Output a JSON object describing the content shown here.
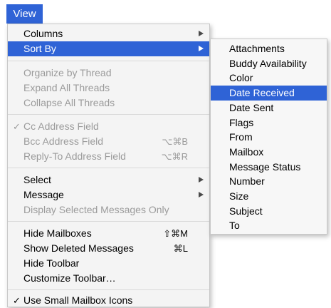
{
  "menubar": {
    "view_label": "View"
  },
  "menu": {
    "columns": "Columns",
    "sort_by": "Sort By",
    "organize_by_thread": "Organize by Thread",
    "expand_all_threads": "Expand All Threads",
    "collapse_all_threads": "Collapse All Threads",
    "cc_address_field": "Cc Address Field",
    "bcc_address_field": "Bcc Address Field",
    "bcc_shortcut": "⌥⌘B",
    "reply_to_address_field": "Reply-To Address Field",
    "reply_to_shortcut": "⌥⌘R",
    "select": "Select",
    "message": "Message",
    "display_selected_messages_only": "Display Selected Messages Only",
    "hide_mailboxes": "Hide Mailboxes",
    "hide_mailboxes_shortcut": "⇧⌘M",
    "show_deleted_messages": "Show Deleted Messages",
    "show_deleted_shortcut": "⌘L",
    "hide_toolbar": "Hide Toolbar",
    "customize_toolbar": "Customize Toolbar…",
    "use_small_mailbox_icons": "Use Small Mailbox Icons",
    "checkmark": "✓"
  },
  "submenu": {
    "items": [
      "Attachments",
      "Buddy Availability",
      "Color",
      "Date Received",
      "Date Sent",
      "Flags",
      "From",
      "Mailbox",
      "Message Status",
      "Number",
      "Size",
      "Subject",
      "To"
    ],
    "selected": "Date Received"
  },
  "colors": {
    "highlight": "#2f63d6",
    "menu_background": "#f4f4f4",
    "disabled_text": "#9b9b9b"
  }
}
